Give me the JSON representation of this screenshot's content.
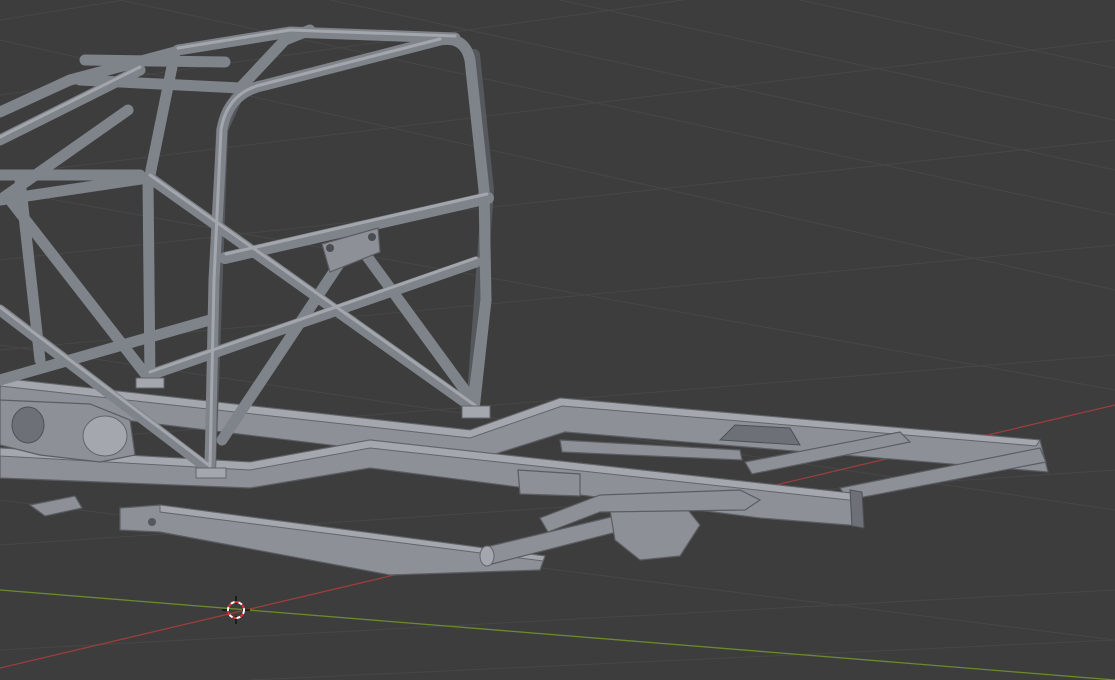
{
  "viewport": {
    "background_color": "#3d3d3d",
    "grid_color": "#474747",
    "x_axis_color": "#9a3d3d",
    "y_axis_color": "#6b8a2c",
    "model_color": "#8d9197",
    "cursor_icon": "3d-cursor-icon"
  }
}
